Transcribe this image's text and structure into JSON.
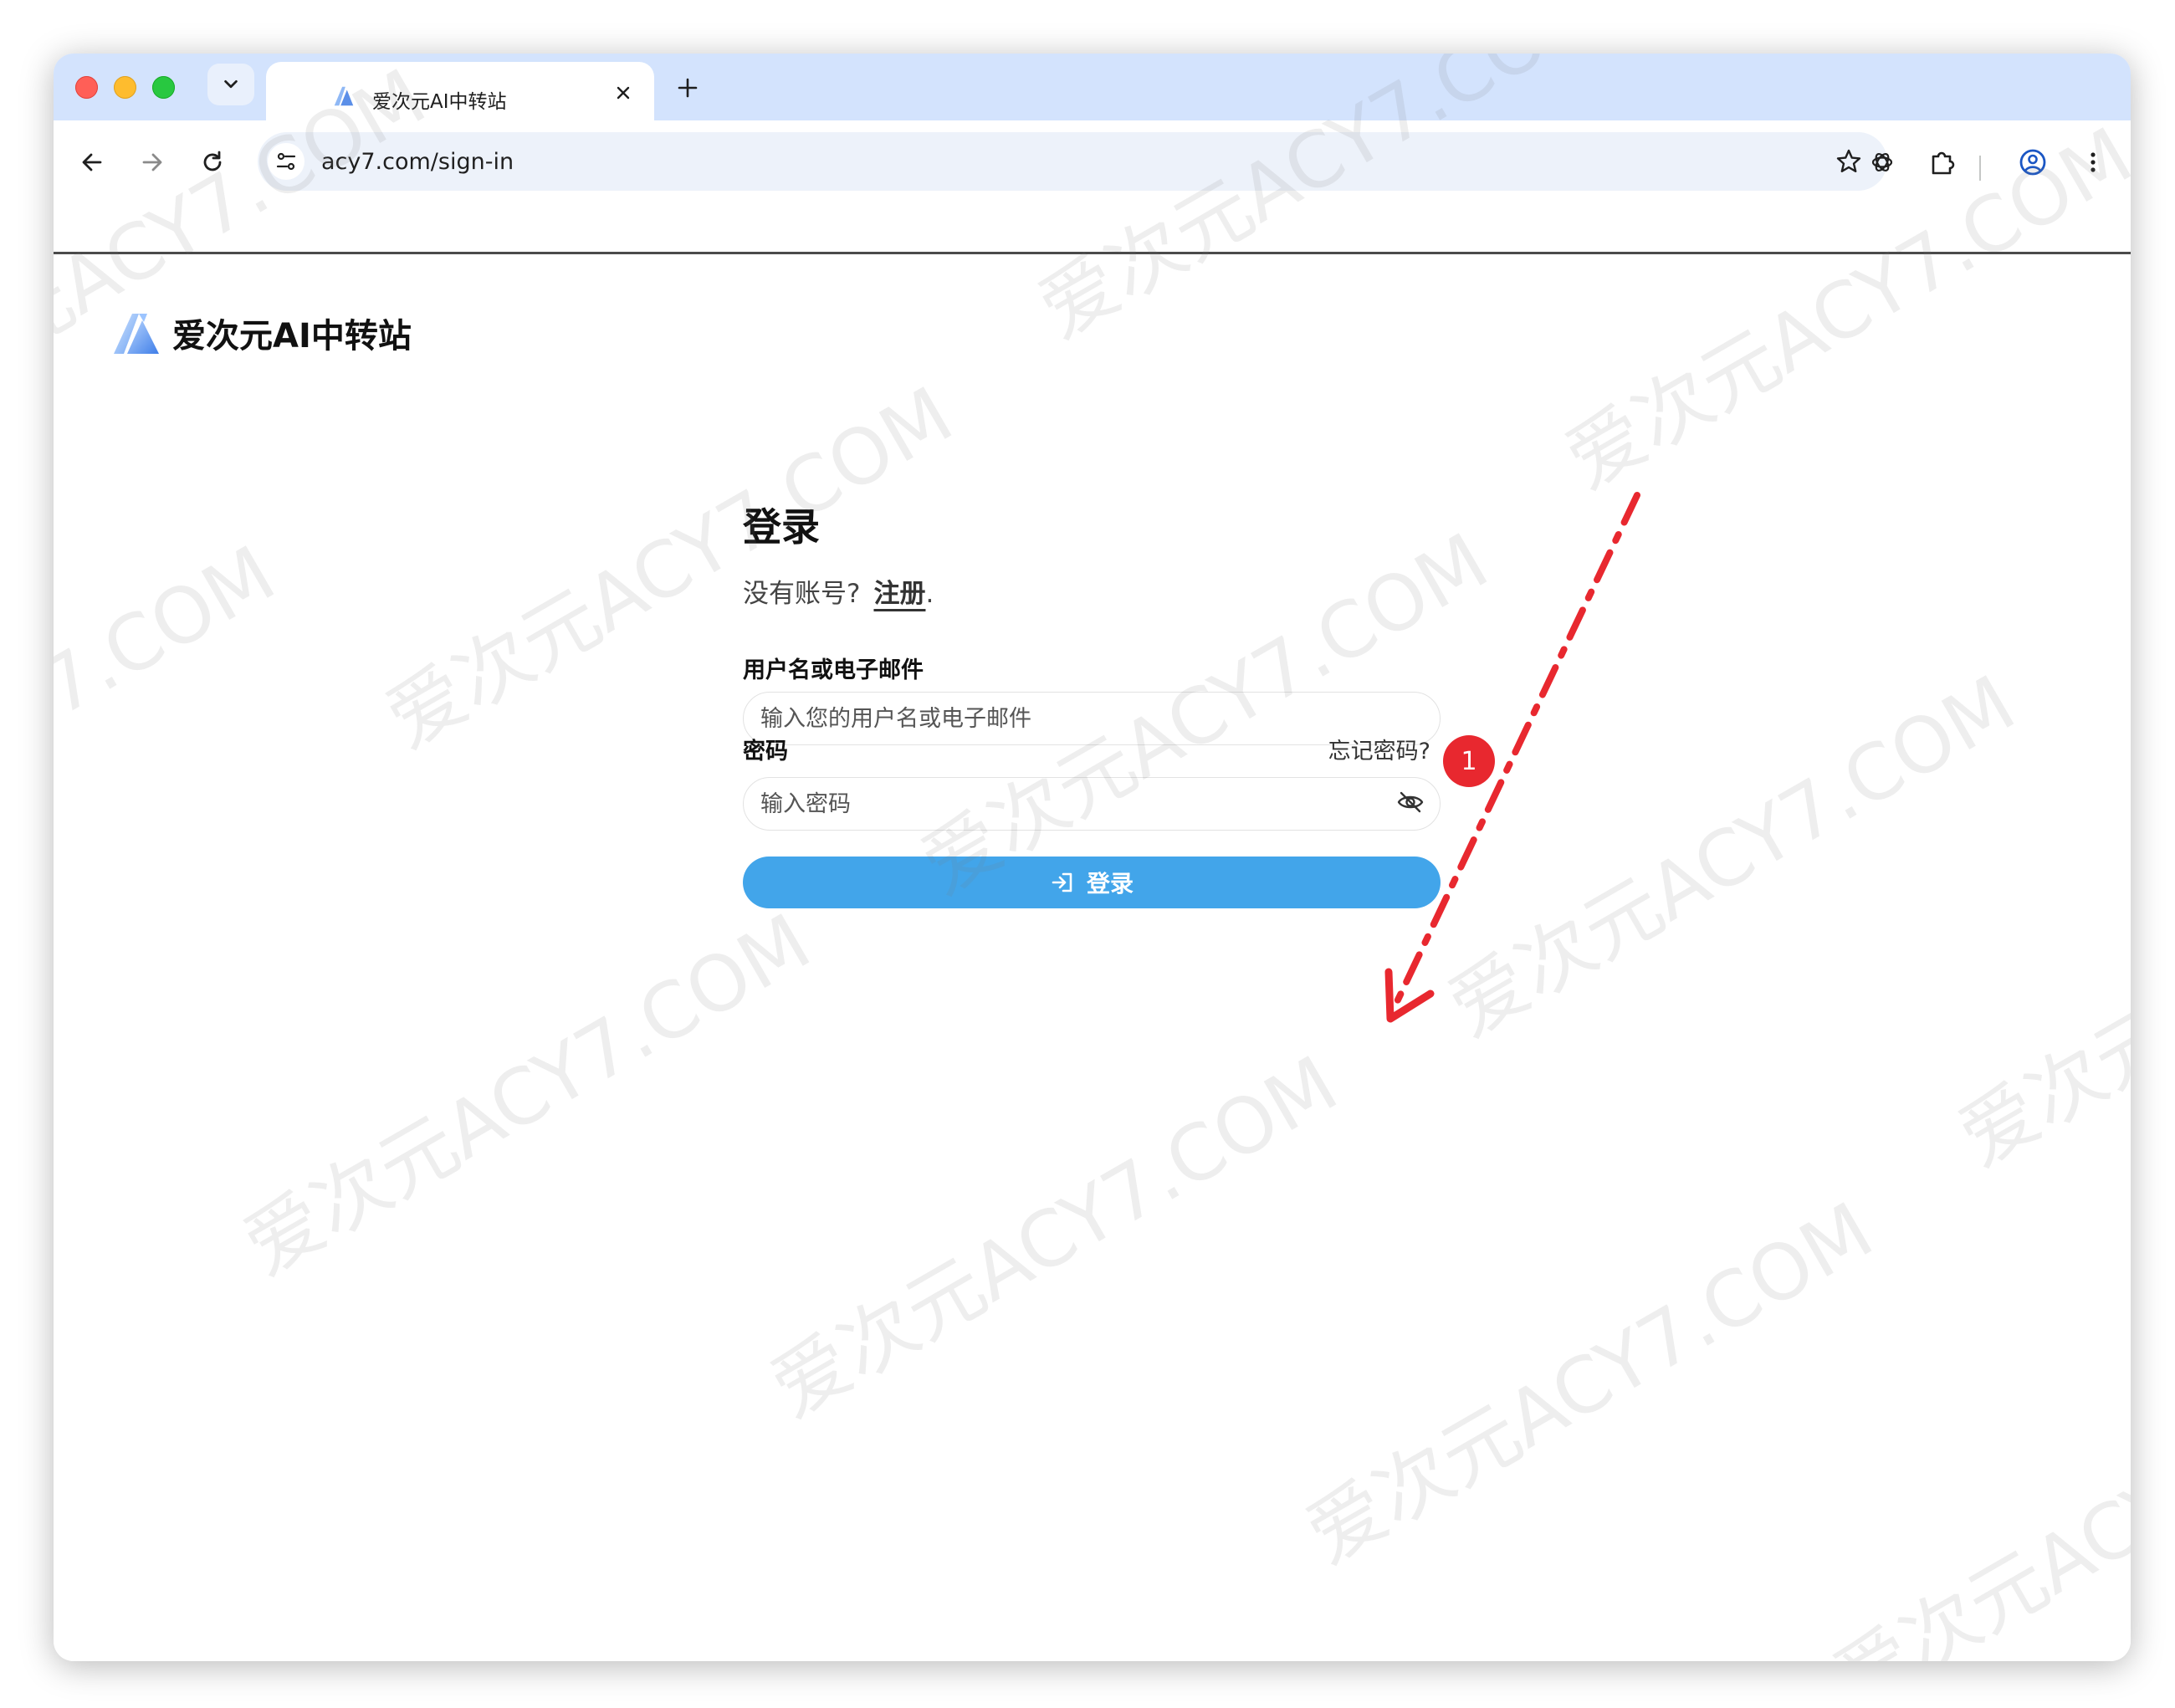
{
  "browser": {
    "tab": {
      "title": "爱次元AI中转站",
      "favicon": "site-logo"
    },
    "url": "acy7.com/sign-in",
    "icons": [
      "back-arrow-icon",
      "forward-arrow-icon",
      "reload-icon",
      "site-settings-icon",
      "star-icon",
      "openai-extension-icon",
      "extensions-puzzle-icon",
      "profile-icon",
      "more-vert-icon"
    ]
  },
  "site": {
    "brand_name": "爱次元AI中转站"
  },
  "login": {
    "title": "登录",
    "no_account_prompt": "没有账号?",
    "signup_link": "注册",
    "signup_suffix": ".",
    "username_label": "用户名或电子邮件",
    "username_placeholder": "输入您的用户名或电子邮件",
    "password_label": "密码",
    "forgot_password": "忘记密码?",
    "password_placeholder": "输入密码",
    "submit_label": "登录"
  },
  "annotation": {
    "step_number": "1",
    "arrow_color": "#e8282f"
  },
  "watermark": {
    "text": "爱次元ACY7.COM"
  },
  "colors": {
    "titlebar": "#d3e3fd",
    "button": "#42a5ea",
    "badge": "#e8282f"
  }
}
